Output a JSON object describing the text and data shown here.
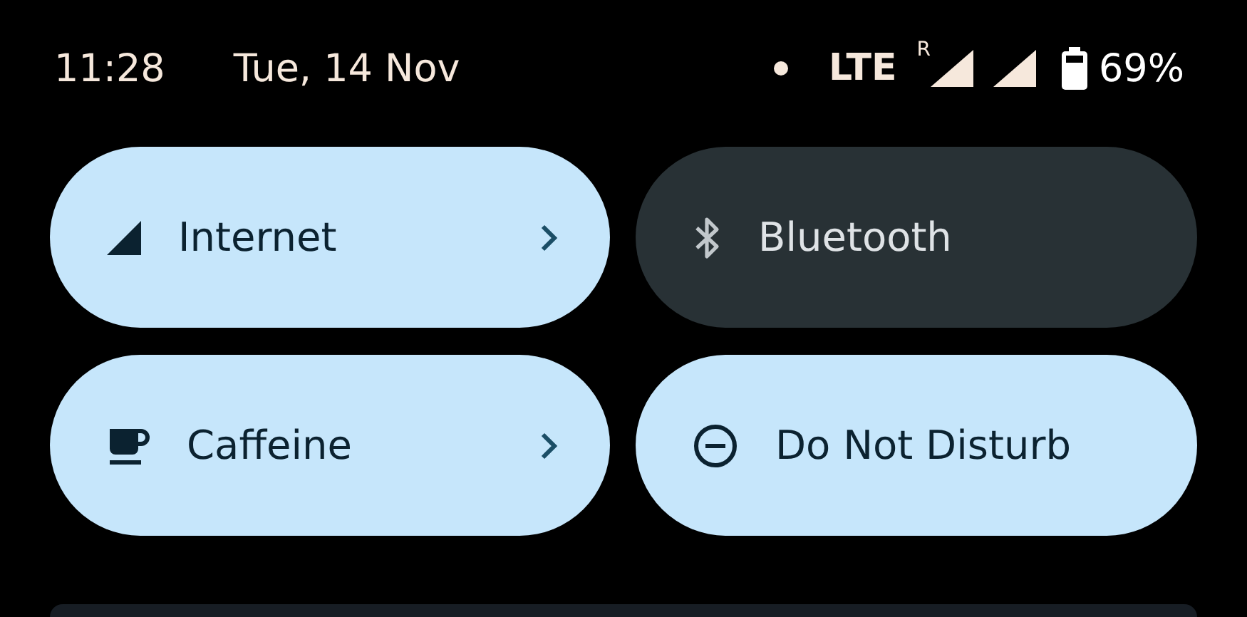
{
  "status_bar": {
    "time": "11:28",
    "date": "Tue, 14 Nov",
    "notification_dot": true,
    "network": "LTE",
    "roaming": "R",
    "battery": "69%"
  },
  "tiles": [
    {
      "kind": "internet",
      "label": "Internet",
      "on": true,
      "chevron": true
    },
    {
      "kind": "bluetooth",
      "label": "Bluetooth",
      "on": false,
      "chevron": false
    },
    {
      "kind": "caffeine",
      "label": "Caffeine",
      "on": true,
      "chevron": true
    },
    {
      "kind": "dnd",
      "label": "Do Not Disturb",
      "on": true,
      "chevron": false
    }
  ]
}
